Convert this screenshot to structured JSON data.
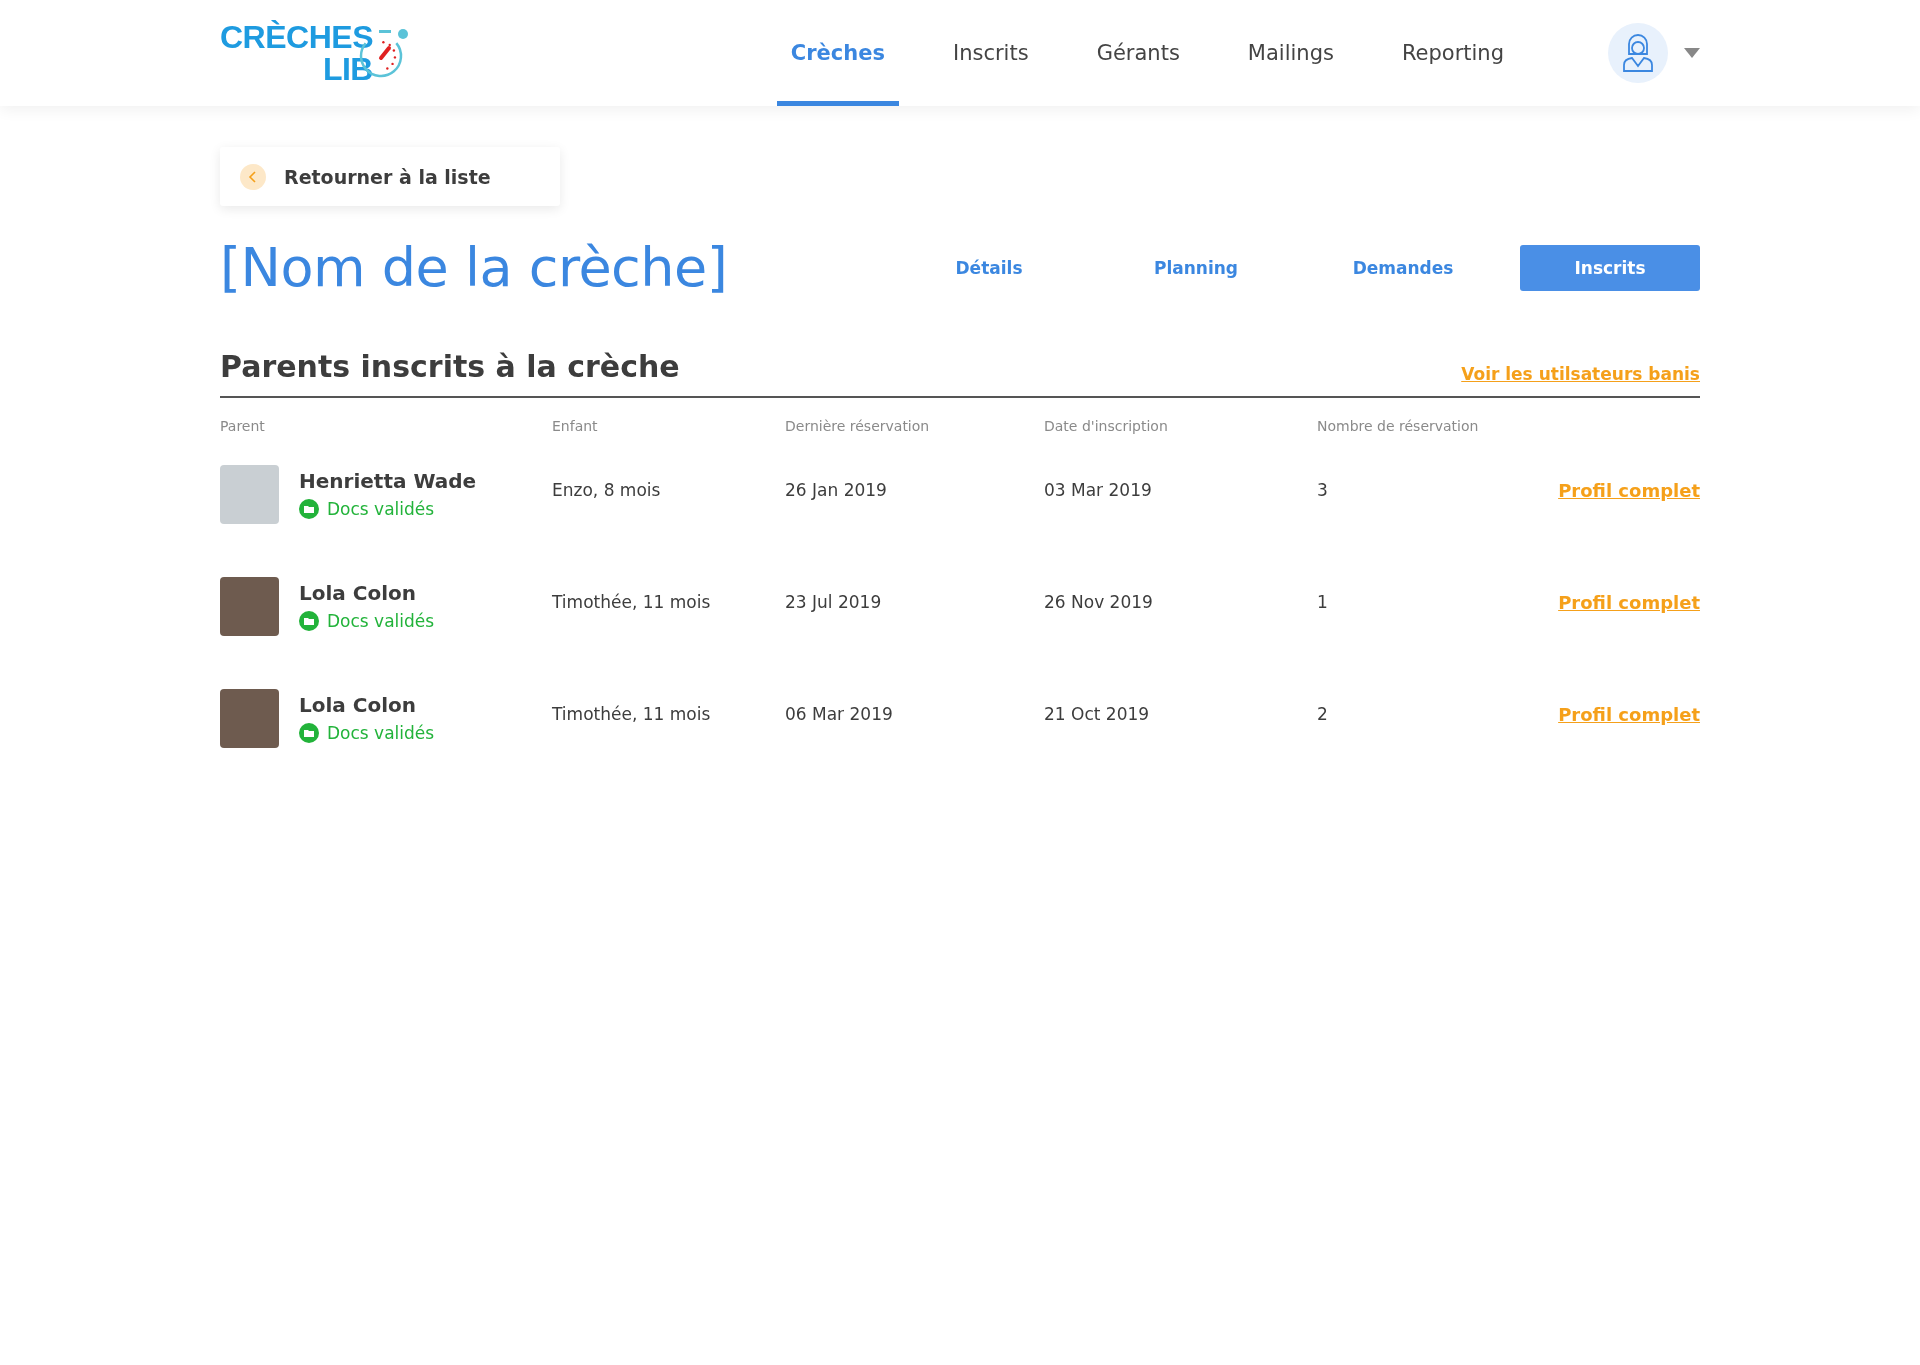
{
  "logo": {
    "line1": "CRÈCHES",
    "line2": "LIB"
  },
  "nav": [
    {
      "label": "Crèches",
      "selected": true
    },
    {
      "label": "Inscrits",
      "selected": false
    },
    {
      "label": "Gérants",
      "selected": false
    },
    {
      "label": "Mailings",
      "selected": false
    },
    {
      "label": "Reporting",
      "selected": false
    }
  ],
  "back_button": "Retourner à la liste",
  "title": "[Nom de la crèche]",
  "tabs": [
    {
      "label": "Détails",
      "selected": false
    },
    {
      "label": "Planning",
      "selected": false
    },
    {
      "label": "Demandes",
      "selected": false
    },
    {
      "label": "Inscrits",
      "selected": true
    }
  ],
  "section": {
    "heading": "Parents inscrits à la crèche",
    "link": "Voir les utilsateurs banis"
  },
  "table": {
    "columns": [
      "Parent",
      "Enfant",
      "Dernière réservation",
      "Date d'inscription",
      "Nombre de réservation"
    ],
    "rows": [
      {
        "name": "Henrietta Wade",
        "status": "Docs validés",
        "validated": true,
        "child": "Enzo, 8 mois",
        "last": "26 Jan 2019",
        "date": "03 Mar 2019",
        "count": "3",
        "link": "Profil complet"
      },
      {
        "name": "Lola Colon",
        "status": "Docs validés",
        "validated": true,
        "child": "Timothée, 11 mois",
        "last": "23 Jul 2019",
        "date": "26 Nov 2019",
        "count": "1",
        "link": "Profil complet"
      },
      {
        "name": "Lola Colon",
        "status": "Docs validés",
        "validated": true,
        "child": "Timothée, 11 mois",
        "last": "06 Mar 2019",
        "date": "21 Oct 2019",
        "count": "2",
        "link": "Profil complet"
      }
    ]
  }
}
